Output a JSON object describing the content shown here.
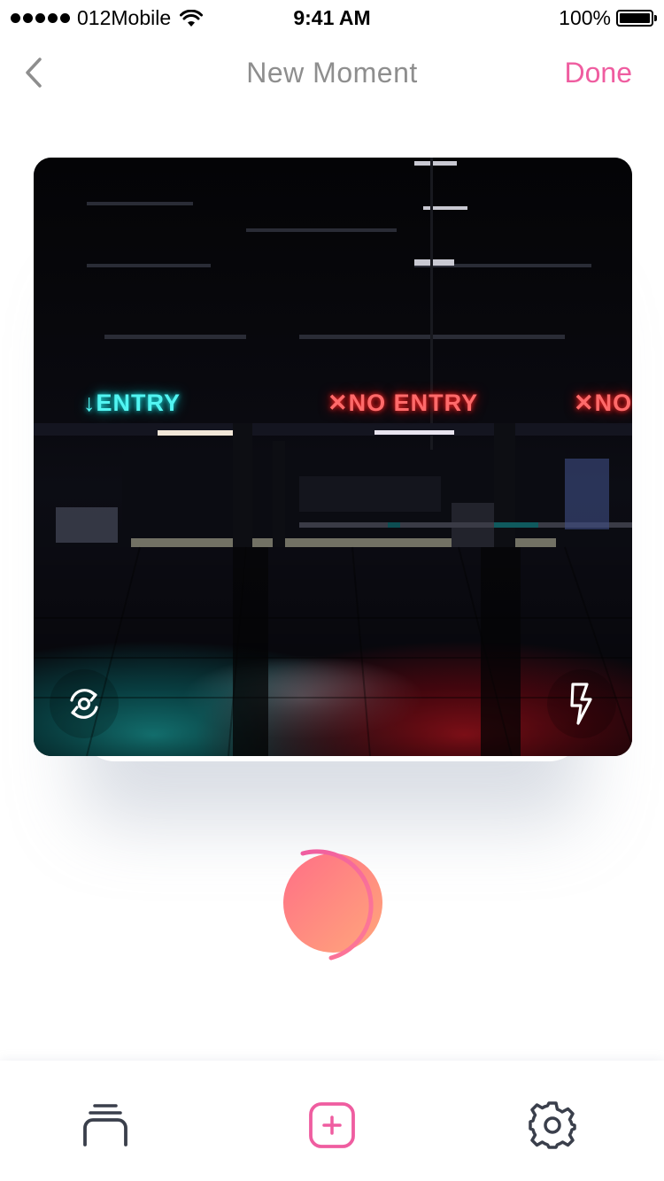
{
  "status_bar": {
    "carrier": "012Mobile",
    "time": "9:41 AM",
    "battery": "100%",
    "icons": [
      "signal-dots",
      "wifi-icon",
      "battery-icon"
    ]
  },
  "nav": {
    "title": "New Moment",
    "done_label": "Done",
    "back_icon": "chevron-left-icon"
  },
  "camera": {
    "signs": {
      "entry": "↓ENTRY",
      "no_entry": "✕NO ENTRY",
      "no_entry_partial": "✕NO E"
    },
    "flip_icon": "flip-camera-icon",
    "flash_icon": "flash-icon"
  },
  "shutter": {
    "icon": "shutter-icon"
  },
  "tab_bar": {
    "items": [
      {
        "icon": "stack-icon",
        "name": "moments"
      },
      {
        "icon": "add-square-icon",
        "name": "add"
      },
      {
        "icon": "gear-icon",
        "name": "settings"
      }
    ]
  },
  "colors": {
    "accent": "#ef5da0",
    "title_gray": "#8e8e8e",
    "icon_dark": "#3a3f4b",
    "shutter_start": "#ff6f86",
    "shutter_end": "#ffa77b"
  }
}
